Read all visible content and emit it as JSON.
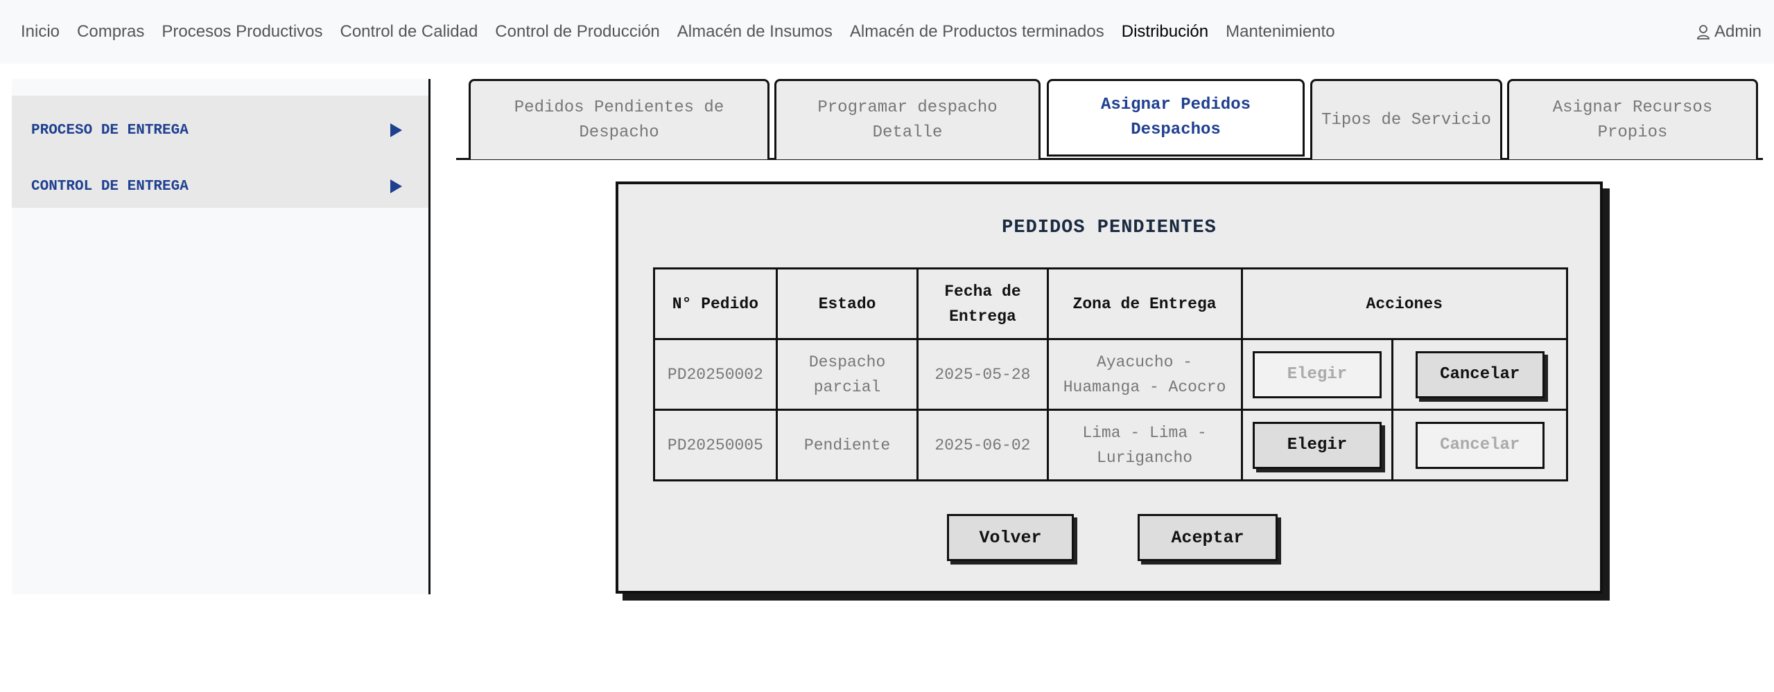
{
  "nav": {
    "items": [
      {
        "label": "Inicio"
      },
      {
        "label": "Compras"
      },
      {
        "label": "Procesos Productivos"
      },
      {
        "label": "Control de Calidad"
      },
      {
        "label": "Control de Producción"
      },
      {
        "label": "Almacén de Insumos"
      },
      {
        "label": "Almacén de Productos terminados"
      },
      {
        "label": "Distribución",
        "active": true
      },
      {
        "label": "Mantenimiento"
      }
    ],
    "user_label": "Admin",
    "user_icon": "user-icon"
  },
  "sidebar": {
    "items": [
      {
        "label": "PROCESO DE ENTREGA",
        "icon": "triangle-right-icon"
      },
      {
        "label": "CONTROL DE ENTREGA",
        "icon": "triangle-right-icon"
      }
    ]
  },
  "tabs": [
    {
      "label": "Pedidos Pendientes de Despacho"
    },
    {
      "label": "Programar despacho Detalle"
    },
    {
      "label": "Asignar Pedidos Despachos",
      "active": true
    },
    {
      "label": "Tipos de Servicio"
    },
    {
      "label": "Asignar Recursos Propios"
    }
  ],
  "modal": {
    "title": "PEDIDOS PENDIENTES",
    "columns": [
      "N° Pedido",
      "Estado",
      "Fecha de Entrega",
      "Zona de Entrega",
      "Acciones"
    ],
    "rows": [
      {
        "pedido": "PD20250002",
        "estado": "Despacho parcial",
        "fecha": "2025-05-28",
        "zona": "Ayacucho - Huamanga - Acocro",
        "elegir_label": "Elegir",
        "elegir_enabled": false,
        "cancelar_label": "Cancelar",
        "cancelar_enabled": true
      },
      {
        "pedido": "PD20250005",
        "estado": "Pendiente",
        "fecha": "2025-06-02",
        "zona": "Lima - Lima - Lurigancho",
        "elegir_label": "Elegir",
        "elegir_enabled": true,
        "cancelar_label": "Cancelar",
        "cancelar_enabled": false
      }
    ],
    "volver_label": "Volver",
    "aceptar_label": "Aceptar"
  },
  "colors": {
    "accent": "#1f3f8f",
    "nav_bg": "#f8f9fa",
    "panel_bg": "#ececec",
    "border": "#111111"
  }
}
